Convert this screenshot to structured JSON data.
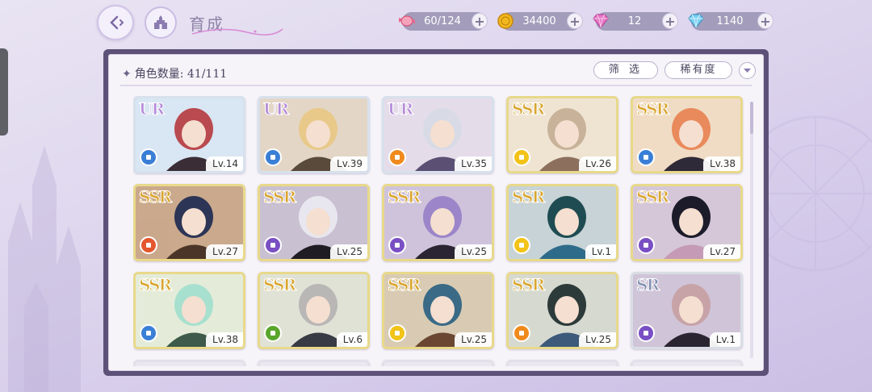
{
  "header": {
    "title": "育成",
    "resources": [
      {
        "icon": "candy-icon",
        "value": "60/124"
      },
      {
        "icon": "gold-coin-icon",
        "value": "34400"
      },
      {
        "icon": "pink-diamond-icon",
        "value": "12"
      },
      {
        "icon": "blue-diamond-icon",
        "value": "1140"
      }
    ],
    "plus_label": "+"
  },
  "panel": {
    "count_label": "角色数量: 41/111",
    "filter_label": "筛 选",
    "rarity_sort_label": "稀有度"
  },
  "colors": {
    "panel_frame": "#5d5178",
    "attr_blue": "#3a7fd6",
    "attr_orange": "#f08a1c",
    "attr_yellow": "#f2c318",
    "attr_purple": "#7a4fc4",
    "attr_green": "#5aa62c",
    "attr_red": "#e4572e"
  },
  "cards": [
    {
      "rarity": "UR",
      "level": "Lv.14",
      "attr_color": "#3a7fd6",
      "art": [
        "#d9e6f3",
        "#b94a4f",
        "#3a2d36"
      ]
    },
    {
      "rarity": "UR",
      "level": "Lv.39",
      "attr_color": "#3a7fd6",
      "art": [
        "#e3d6c6",
        "#e8c98a",
        "#5a4a3c"
      ]
    },
    {
      "rarity": "UR",
      "level": "Lv.35",
      "attr_color": "#f08a1c",
      "art": [
        "#e5dcea",
        "#d8dbe6",
        "#5b4f74"
      ]
    },
    {
      "rarity": "SSR",
      "level": "Lv.26",
      "attr_color": "#f2c318",
      "art": [
        "#efe4d2",
        "#c8b39a",
        "#8c6f5c"
      ]
    },
    {
      "rarity": "SSR",
      "level": "Lv.38",
      "attr_color": "#3a7fd6",
      "art": [
        "#f0dcc4",
        "#e98a5c",
        "#2f2a38"
      ]
    },
    {
      "rarity": "SSR",
      "level": "Lv.27",
      "attr_color": "#e4572e",
      "art": [
        "#caa98c",
        "#2d3556",
        "#4a3528"
      ]
    },
    {
      "rarity": "SSR",
      "level": "Lv.25",
      "attr_color": "#7a4fc4",
      "art": [
        "#c9c0d2",
        "#e8e6ee",
        "#1f1c24"
      ]
    },
    {
      "rarity": "SSR",
      "level": "Lv.25",
      "attr_color": "#7a4fc4",
      "art": [
        "#cfc3dc",
        "#9c86c9",
        "#2b2432"
      ]
    },
    {
      "rarity": "SSR",
      "level": "Lv.1",
      "attr_color": "#f2c318",
      "art": [
        "#c7d3d6",
        "#1f4c52",
        "#2e6b8a"
      ]
    },
    {
      "rarity": "SSR",
      "level": "Lv.27",
      "attr_color": "#7a4fc4",
      "art": [
        "#d5c7d8",
        "#1c1b2a",
        "#c59ab6"
      ]
    },
    {
      "rarity": "SSR",
      "level": "Lv.38",
      "attr_color": "#3a7fd6",
      "art": [
        "#e4ecd9",
        "#a8e0cf",
        "#3d5a4a"
      ]
    },
    {
      "rarity": "SSR",
      "level": "Lv.6",
      "attr_color": "#5aa62c",
      "art": [
        "#dfe2d5",
        "#b9b7b5",
        "#383a44"
      ]
    },
    {
      "rarity": "SSR",
      "level": "Lv.25",
      "attr_color": "#f2c318",
      "art": [
        "#d9cbb3",
        "#3a6a86",
        "#6b4630"
      ]
    },
    {
      "rarity": "SSR",
      "level": "Lv.25",
      "attr_color": "#f08a1c",
      "art": [
        "#d6d9cf",
        "#2c3a3a",
        "#3d5a7a"
      ]
    },
    {
      "rarity": "SR",
      "level": "Lv.1",
      "attr_color": "#7a4fc4",
      "art": [
        "#d0c4d8",
        "#c7a3a8",
        "#2a2430"
      ]
    }
  ]
}
